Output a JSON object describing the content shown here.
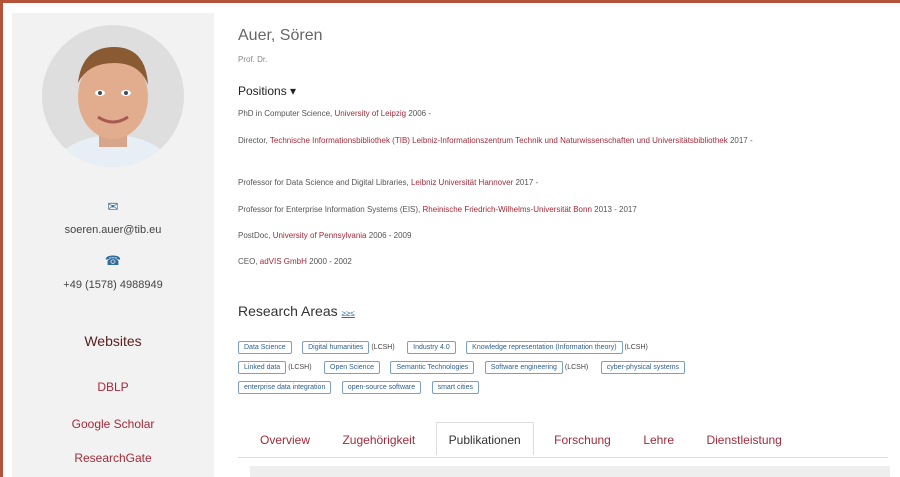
{
  "profile": {
    "name": "Auer, Sören",
    "title": "Prof. Dr.",
    "email": "soeren.auer@tib.eu",
    "phone": "+49 (1578) 4988949"
  },
  "icons": {
    "email": "envelope-icon",
    "phone": "phone-icon"
  },
  "websites": {
    "heading": "Websites",
    "links": [
      "DBLP",
      "Google Scholar",
      "ResearchGate"
    ]
  },
  "positions": {
    "heading": "Positions ▾",
    "items": [
      {
        "role": "PhD in Computer Science, ",
        "org": "University of Leipzig",
        "years": " 2006 -"
      },
      {
        "role": "Director, ",
        "org": "Technische Informationsbibliothek (TIB) Leibniz-Informationszentrum Technik und Naturwissenschaften und Universitätsbibliothek",
        "years": " 2017 -"
      },
      {
        "role": "Professor for Data Science and Digital Libraries, ",
        "org": "Leibniz Universität Hannover",
        "years": " 2017 -"
      },
      {
        "role": "Professor for Enterprise Information Systems (EIS), ",
        "org": "Rheinische Friedrich-Wilhelms-Universität Bonn",
        "years": " 2013 - 2017"
      },
      {
        "role": "PostDoc, ",
        "org": "University of Pennsylvania",
        "years": " 2006 - 2009"
      },
      {
        "role": "CEO, ",
        "org": "adVIS GmbH",
        "years": " 2000 - 2002"
      }
    ]
  },
  "research": {
    "heading": "Research Areas",
    "icon_label": "≥≥≤",
    "rows": [
      [
        {
          "label": "Data Science",
          "lcsh": ""
        },
        {
          "label": "Digital humanities",
          "lcsh": "(LCSH)"
        },
        {
          "label": "Industry 4.0",
          "lcsh": ""
        },
        {
          "label": "Knowledge representation (Information theory)",
          "lcsh": "(LCSH)"
        }
      ],
      [
        {
          "label": "Linked data",
          "lcsh": "(LCSH)"
        },
        {
          "label": "Open Science",
          "lcsh": ""
        },
        {
          "label": "Semantic Technologies",
          "lcsh": ""
        },
        {
          "label": "Software engineering",
          "lcsh": "(LCSH)"
        },
        {
          "label": "cyber-physical systems",
          "lcsh": ""
        }
      ],
      [
        {
          "label": "enterprise data integration",
          "lcsh": ""
        },
        {
          "label": "open-source software",
          "lcsh": ""
        },
        {
          "label": "smart cities",
          "lcsh": ""
        }
      ]
    ]
  },
  "tabs": [
    {
      "label": "Overview",
      "active": false
    },
    {
      "label": "Zugehörigkeit",
      "active": false
    },
    {
      "label": "Publikationen",
      "active": true
    },
    {
      "label": "Forschung",
      "active": false
    },
    {
      "label": "Lehre",
      "active": false
    },
    {
      "label": "Dienstleistung",
      "active": false
    }
  ],
  "colors": {
    "link": "#a52a3a",
    "tag_border": "#7aa0c8",
    "frame_accent": "#b5533a"
  }
}
